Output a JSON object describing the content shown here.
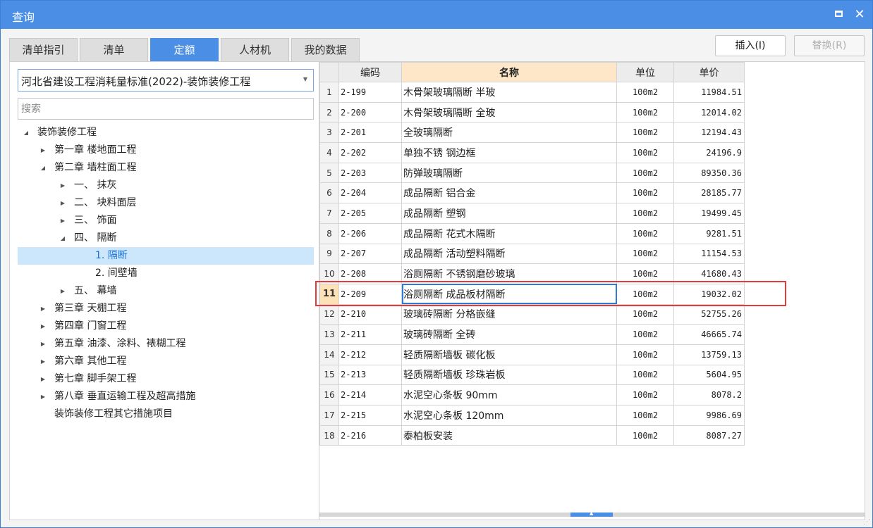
{
  "window": {
    "title": "查询",
    "maximize_icon": "maximize-icon",
    "close_glyph": "✕"
  },
  "tabs": [
    {
      "label": "清单指引",
      "active": false
    },
    {
      "label": "清单",
      "active": false
    },
    {
      "label": "定额",
      "active": true
    },
    {
      "label": "人材机",
      "active": false
    },
    {
      "label": "我的数据",
      "active": false
    }
  ],
  "actions": {
    "insert_label": "插入(I)",
    "replace_label": "替换(R)"
  },
  "library_select": {
    "value": "河北省建设工程消耗量标准(2022)-装饰装修工程"
  },
  "search": {
    "placeholder": "搜索",
    "value": ""
  },
  "tree": [
    {
      "label": "装饰装修工程",
      "level": 0,
      "expanded": true
    },
    {
      "label": "第一章 楼地面工程",
      "level": 1,
      "expanded": false
    },
    {
      "label": "第二章 墙柱面工程",
      "level": 1,
      "expanded": true
    },
    {
      "label": "一、 抹灰",
      "level": 2,
      "expanded": false
    },
    {
      "label": "二、 块料面层",
      "level": 2,
      "expanded": false
    },
    {
      "label": "三、 饰面",
      "level": 2,
      "expanded": false
    },
    {
      "label": "四、 隔断",
      "level": 2,
      "expanded": true
    },
    {
      "label": "1. 隔断",
      "level": 3,
      "leaf": true,
      "selected": true
    },
    {
      "label": "2. 间壁墙",
      "level": 3,
      "leaf": true
    },
    {
      "label": "五、 幕墙",
      "level": 2,
      "expanded": false
    },
    {
      "label": "第三章 天棚工程",
      "level": 1,
      "expanded": false
    },
    {
      "label": "第四章 门窗工程",
      "level": 1,
      "expanded": false
    },
    {
      "label": "第五章 油漆、涂料、裱糊工程",
      "level": 1,
      "expanded": false
    },
    {
      "label": "第六章 其他工程",
      "level": 1,
      "expanded": false
    },
    {
      "label": "第七章 脚手架工程",
      "level": 1,
      "expanded": false
    },
    {
      "label": "第八章 垂直运输工程及超高措施",
      "level": 1,
      "expanded": false
    },
    {
      "label": "装饰装修工程其它措施项目",
      "level": 1,
      "leaf": true
    }
  ],
  "table": {
    "headers": {
      "code": "编码",
      "name": "名称",
      "unit": "单位",
      "price": "单价"
    },
    "rows": [
      {
        "idx": "1",
        "code": "2-199",
        "name": "木骨架玻璃隔断 半玻",
        "unit": "100m2",
        "price": "11984.51"
      },
      {
        "idx": "2",
        "code": "2-200",
        "name": "木骨架玻璃隔断 全玻",
        "unit": "100m2",
        "price": "12014.02"
      },
      {
        "idx": "3",
        "code": "2-201",
        "name": "全玻璃隔断",
        "unit": "100m2",
        "price": "12194.43"
      },
      {
        "idx": "4",
        "code": "2-202",
        "name": "单独不锈 钢边框",
        "unit": "100m2",
        "price": "24196.9"
      },
      {
        "idx": "5",
        "code": "2-203",
        "name": "防弹玻璃隔断",
        "unit": "100m2",
        "price": "89350.36"
      },
      {
        "idx": "6",
        "code": "2-204",
        "name": "成品隔断 铝合金",
        "unit": "100m2",
        "price": "28185.77"
      },
      {
        "idx": "7",
        "code": "2-205",
        "name": "成品隔断 塑钢",
        "unit": "100m2",
        "price": "19499.45"
      },
      {
        "idx": "8",
        "code": "2-206",
        "name": "成品隔断 花式木隔断",
        "unit": "100m2",
        "price": "9281.51"
      },
      {
        "idx": "9",
        "code": "2-207",
        "name": "成品隔断 活动塑料隔断",
        "unit": "100m2",
        "price": "11154.53"
      },
      {
        "idx": "10",
        "code": "2-208",
        "name": "浴厕隔断 不锈钢磨砂玻璃",
        "unit": "100m2",
        "price": "41680.43"
      },
      {
        "idx": "11",
        "code": "2-209",
        "name": "浴厕隔断 成品板材隔断",
        "unit": "100m2",
        "price": "19032.02",
        "current": true
      },
      {
        "idx": "12",
        "code": "2-210",
        "name": "玻璃砖隔断 分格嵌缝",
        "unit": "100m2",
        "price": "52755.26"
      },
      {
        "idx": "13",
        "code": "2-211",
        "name": "玻璃砖隔断 全砖",
        "unit": "100m2",
        "price": "46665.74"
      },
      {
        "idx": "14",
        "code": "2-212",
        "name": "轻质隔断墙板 碳化板",
        "unit": "100m2",
        "price": "13759.13"
      },
      {
        "idx": "15",
        "code": "2-213",
        "name": "轻质隔断墙板 珍珠岩板",
        "unit": "100m2",
        "price": "5604.95"
      },
      {
        "idx": "16",
        "code": "2-214",
        "name": "水泥空心条板 90mm",
        "unit": "100m2",
        "price": "8078.2"
      },
      {
        "idx": "17",
        "code": "2-215",
        "name": "水泥空心条板 120mm",
        "unit": "100m2",
        "price": "9986.69"
      },
      {
        "idx": "18",
        "code": "2-216",
        "name": "泰柏板安装",
        "unit": "100m2",
        "price": "8087.27"
      }
    ]
  },
  "colors": {
    "titlebar": "#4a8ee6",
    "active_tab": "#4a8ee6",
    "name_header": "#fde7c8",
    "selected_tree": "#cce6fb",
    "highlight_border": "#e03c3c"
  }
}
